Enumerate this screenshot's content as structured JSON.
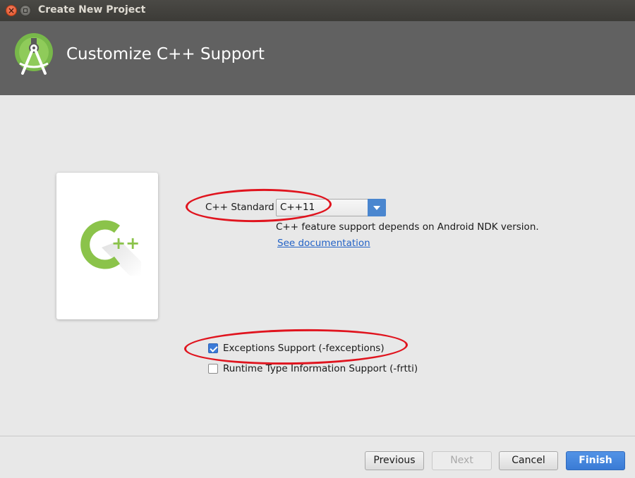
{
  "window": {
    "title": "Create New Project",
    "close_glyph": "×"
  },
  "header": {
    "title": "Customize C++ Support",
    "logo_icon": "android-studio-logo-icon"
  },
  "card": {
    "logo_icon": "cpp-logo-icon",
    "logo_text": "++",
    "accent_color": "#8bc34a"
  },
  "form": {
    "cpp_standard": {
      "label": "C++ Standard",
      "selected": "C++11",
      "note": "C++ feature support depends on Android NDK version.",
      "link": "See documentation"
    },
    "exceptions": {
      "label": "Exceptions Support (-fexceptions)",
      "checked": true
    },
    "rtti": {
      "label": "Runtime Type Information Support (-frtti)",
      "checked": false
    }
  },
  "annotations": {
    "color": "#e0141e"
  },
  "footer": {
    "previous": "Previous",
    "next": "Next",
    "cancel": "Cancel",
    "finish": "Finish"
  }
}
